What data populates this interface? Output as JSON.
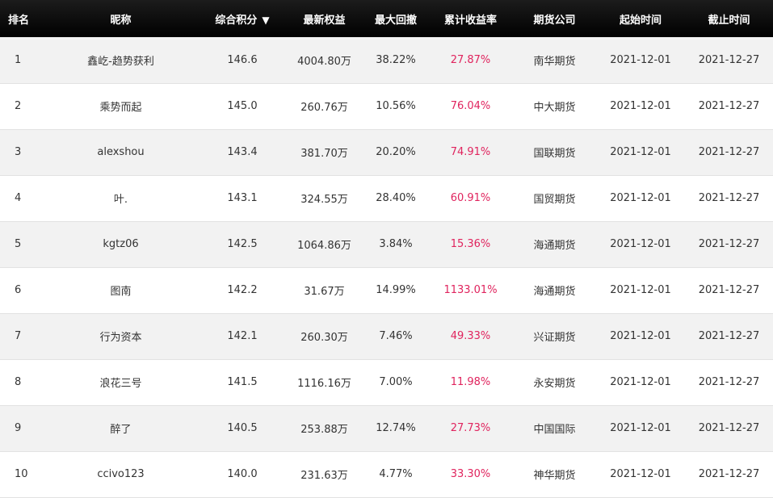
{
  "colors": {
    "header_bg": "#000000",
    "return_color": "#e0245e"
  },
  "header": {
    "rank": "排名",
    "nickname": "昵称",
    "score": "综合积分",
    "score_sort_icon": "triangle-down-icon",
    "equity": "最新权益",
    "drawdown": "最大回撤",
    "return": "累计收益率",
    "company": "期货公司",
    "start": "起始时间",
    "end": "截止时间"
  },
  "rows": [
    {
      "rank": "1",
      "nickname": "鑫屹-趋势获利",
      "score": "146.6",
      "equity": "4004.80万",
      "drawdown": "38.22%",
      "return": "27.87%",
      "company": "南华期货",
      "start": "2021-12-01",
      "end": "2021-12-27"
    },
    {
      "rank": "2",
      "nickname": "乘势而起",
      "score": "145.0",
      "equity": "260.76万",
      "drawdown": "10.56%",
      "return": "76.04%",
      "company": "中大期货",
      "start": "2021-12-01",
      "end": "2021-12-27"
    },
    {
      "rank": "3",
      "nickname": "alexshou",
      "score": "143.4",
      "equity": "381.70万",
      "drawdown": "20.20%",
      "return": "74.91%",
      "company": "国联期货",
      "start": "2021-12-01",
      "end": "2021-12-27"
    },
    {
      "rank": "4",
      "nickname": "叶.",
      "score": "143.1",
      "equity": "324.55万",
      "drawdown": "28.40%",
      "return": "60.91%",
      "company": "国贸期货",
      "start": "2021-12-01",
      "end": "2021-12-27"
    },
    {
      "rank": "5",
      "nickname": "kgtz06",
      "score": "142.5",
      "equity": "1064.86万",
      "drawdown": "3.84%",
      "return": "15.36%",
      "company": "海通期货",
      "start": "2021-12-01",
      "end": "2021-12-27"
    },
    {
      "rank": "6",
      "nickname": "图南",
      "score": "142.2",
      "equity": "31.67万",
      "drawdown": "14.99%",
      "return": "1133.01%",
      "company": "海通期货",
      "start": "2021-12-01",
      "end": "2021-12-27"
    },
    {
      "rank": "7",
      "nickname": "行为资本",
      "score": "142.1",
      "equity": "260.30万",
      "drawdown": "7.46%",
      "return": "49.33%",
      "company": "兴证期货",
      "start": "2021-12-01",
      "end": "2021-12-27"
    },
    {
      "rank": "8",
      "nickname": "浪花三号",
      "score": "141.5",
      "equity": "1116.16万",
      "drawdown": "7.00%",
      "return": "11.98%",
      "company": "永安期货",
      "start": "2021-12-01",
      "end": "2021-12-27"
    },
    {
      "rank": "9",
      "nickname": "醉了",
      "score": "140.5",
      "equity": "253.88万",
      "drawdown": "12.74%",
      "return": "27.73%",
      "company": "中国国际",
      "start": "2021-12-01",
      "end": "2021-12-27"
    },
    {
      "rank": "10",
      "nickname": "ccivo123",
      "score": "140.0",
      "equity": "231.63万",
      "drawdown": "4.77%",
      "return": "33.30%",
      "company": "神华期货",
      "start": "2021-12-01",
      "end": "2021-12-27"
    }
  ]
}
